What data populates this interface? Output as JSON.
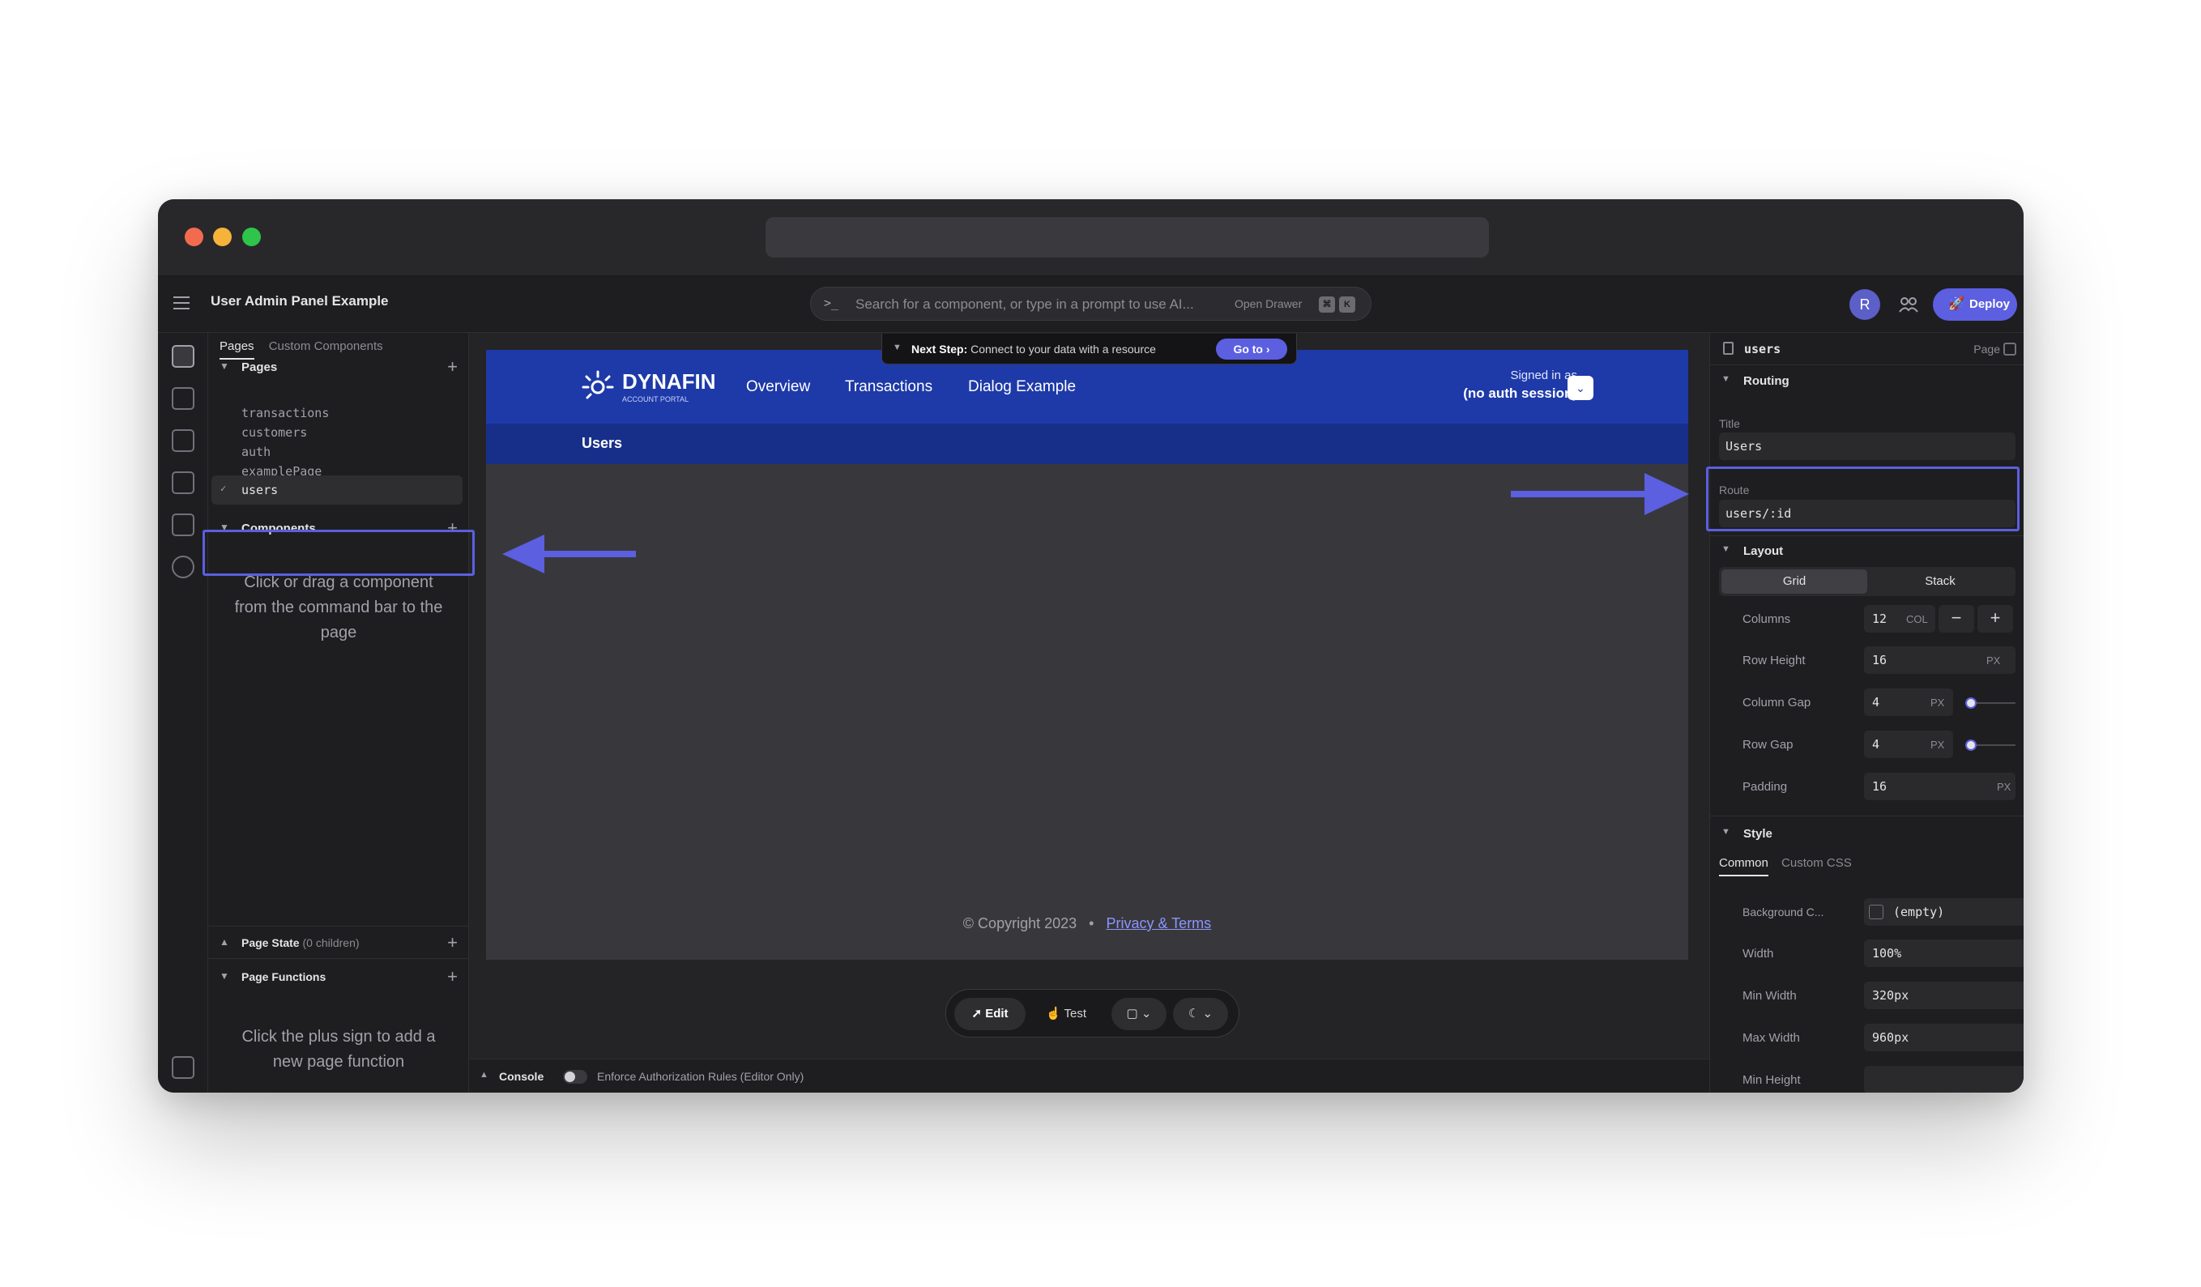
{
  "app": {
    "title": "User Admin Panel Example",
    "deploy_label": "Deploy",
    "avatar_initial": "R",
    "command_bar": {
      "placeholder": "Search for a component, or type in a prompt to use AI...",
      "drawer_label": "Open Drawer",
      "shortcut_keys": [
        "⌘",
        "K"
      ]
    },
    "next_step": {
      "label": "Next Step:",
      "text": "Connect to your data with a resource",
      "button": "Go to"
    }
  },
  "left_panel": {
    "tabs": [
      "Pages",
      "Custom Components"
    ],
    "active_tab": "Pages",
    "pages_header": "Pages",
    "pages": [
      "transactions",
      "customers",
      "auth",
      "examplePage",
      "users"
    ],
    "selected_page": "users",
    "components_header": "Components",
    "components_hint": "Click or drag a component from the command bar to the page",
    "page_state_header": "Page State",
    "page_state_count": "(0 children)",
    "page_functions_header": "Page Functions",
    "page_functions_hint": "Click the plus sign to add a new page function"
  },
  "canvas": {
    "brand": "DYNAFIN",
    "brand_sub": "ACCOUNT PORTAL",
    "nav_links": [
      "Overview",
      "Transactions",
      "Dialog Example"
    ],
    "signed_in_label": "Signed in as",
    "signed_in_value": "(no auth session)",
    "page_heading": "Users",
    "footer_copyright": "© Copyright 2023",
    "footer_separator": "•",
    "footer_link": "Privacy & Terms",
    "colors": {
      "header": "#1e3aa8",
      "subheader": "#182f8a",
      "accent": "#5b5fe0"
    }
  },
  "mode_bar": {
    "edit_label": "Edit",
    "test_label": "Test"
  },
  "console": {
    "label": "Console",
    "rule_label": "Enforce Authorization Rules (Editor Only)"
  },
  "right_panel": {
    "component_name": "users",
    "component_kind": "Page",
    "routing": {
      "header": "Routing",
      "title_label": "Title",
      "title_value": "Users",
      "route_label": "Route",
      "route_value": "users/:id"
    },
    "layout": {
      "header": "Layout",
      "modes": [
        "Grid",
        "Stack"
      ],
      "active_mode": "Grid",
      "columns_label": "Columns",
      "columns_value": "12",
      "columns_unit": "COL",
      "row_height_label": "Row Height",
      "row_height_value": "16",
      "row_height_unit": "PX",
      "column_gap_label": "Column Gap",
      "column_gap_value": "4",
      "column_gap_unit": "PX",
      "row_gap_label": "Row Gap",
      "row_gap_value": "4",
      "row_gap_unit": "PX",
      "padding_label": "Padding",
      "padding_value": "16",
      "padding_unit": "PX"
    },
    "style": {
      "header": "Style",
      "tabs": [
        "Common",
        "Custom CSS"
      ],
      "active_tab": "Common",
      "bg_label": "Background C...",
      "bg_value": "(empty)",
      "width_label": "Width",
      "width_value": "100%",
      "min_width_label": "Min Width",
      "min_width_value": "320px",
      "max_width_label": "Max Width",
      "max_width_value": "960px",
      "min_height_label": "Min Height",
      "min_height_value": ""
    }
  }
}
